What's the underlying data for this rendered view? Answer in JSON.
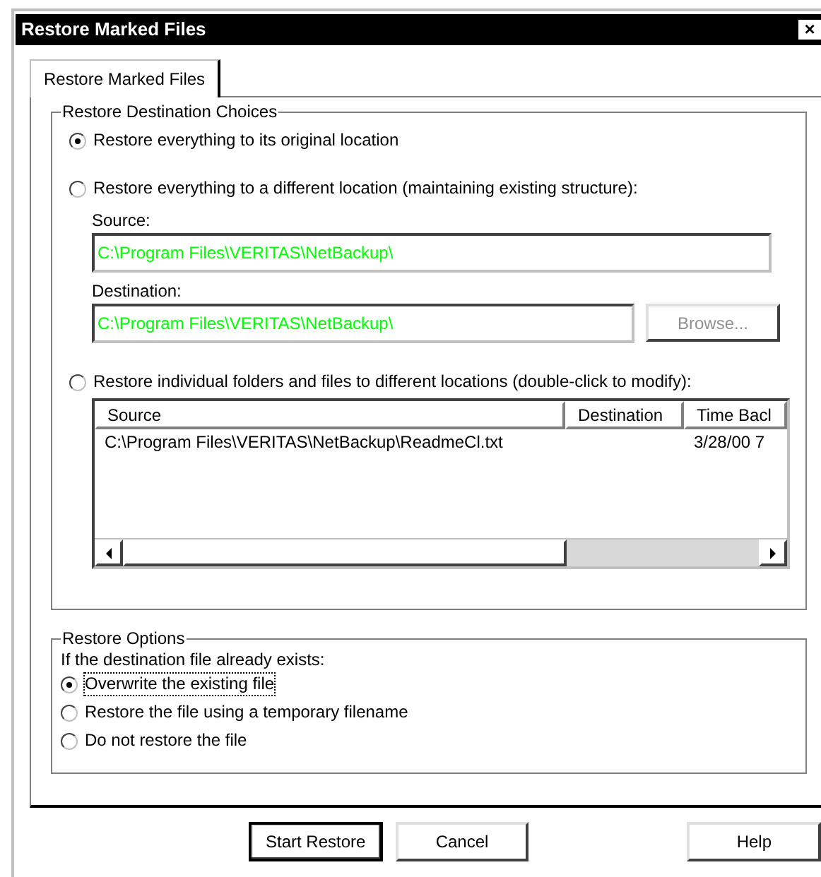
{
  "window": {
    "title": "Restore Marked Files",
    "close": "×"
  },
  "tabs": [
    {
      "label": "Restore Marked Files",
      "selected": true
    }
  ],
  "destination_group": {
    "title": "Restore Destination Choices",
    "choices": [
      {
        "label": "Restore everything to its original location",
        "selected": true
      },
      {
        "label": "Restore everything to a different location (maintaining existing structure):",
        "selected": false
      },
      {
        "label": "Restore individual folders and files to different locations (double-click to modify):",
        "selected": false
      }
    ],
    "source_label": "Source:",
    "source_value": "C:\\Program Files\\VERITAS\\NetBackup\\",
    "destination_label": "Destination:",
    "destination_value": "C:\\Program Files\\VERITAS\\NetBackup\\",
    "browse_button": {
      "label": "Browse...",
      "disabled": true
    },
    "table": {
      "columns": [
        "Source",
        "Destination",
        "Time Bacl"
      ],
      "rows": [
        [
          "C:\\Program Files\\VERITAS\\NetBackup\\ReadmeCl.txt",
          "",
          "3/28/00 7"
        ]
      ]
    }
  },
  "options_group": {
    "title": "Restore Options",
    "prompt": "If the destination file already exists:",
    "choices": [
      {
        "label": "Overwrite the existing file",
        "selected": true
      },
      {
        "label": "Restore the file using a temporary filename",
        "selected": false
      },
      {
        "label": "Do not restore the file",
        "selected": false
      }
    ]
  },
  "buttons": [
    {
      "label": "Start Restore",
      "default": true
    },
    {
      "label": "Cancel",
      "default": false
    },
    {
      "label": "Help",
      "default": false
    }
  ]
}
